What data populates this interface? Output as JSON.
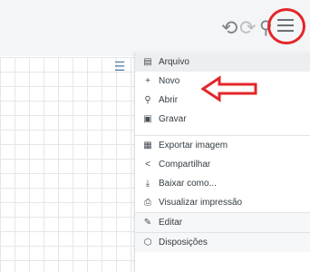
{
  "toolbar": {
    "undo_icon": "undo-icon",
    "redo_icon": "redo-icon",
    "search_icon": "search-icon",
    "menu_icon": "hamburger-menu-icon"
  },
  "menu": {
    "items": [
      {
        "label": "Arquivo",
        "icon": "file-icon"
      },
      {
        "label": "Novo",
        "icon": "plus-icon"
      },
      {
        "label": "Abrir",
        "icon": "search-icon"
      },
      {
        "label": "Gravar",
        "icon": "save-icon"
      },
      {
        "label": "Exportar imagem",
        "icon": "image-export-icon"
      },
      {
        "label": "Compartilhar",
        "icon": "share-icon"
      },
      {
        "label": "Baixar como...",
        "icon": "download-icon"
      },
      {
        "label": "Visualizar impressão",
        "icon": "print-icon"
      },
      {
        "label": "Editar",
        "icon": "pencil-icon"
      },
      {
        "label": "Disposições",
        "icon": "layout-icon"
      }
    ]
  },
  "colors": {
    "annotation_red": "#e3262a",
    "toolbar_bg": "#f4f5f6"
  }
}
